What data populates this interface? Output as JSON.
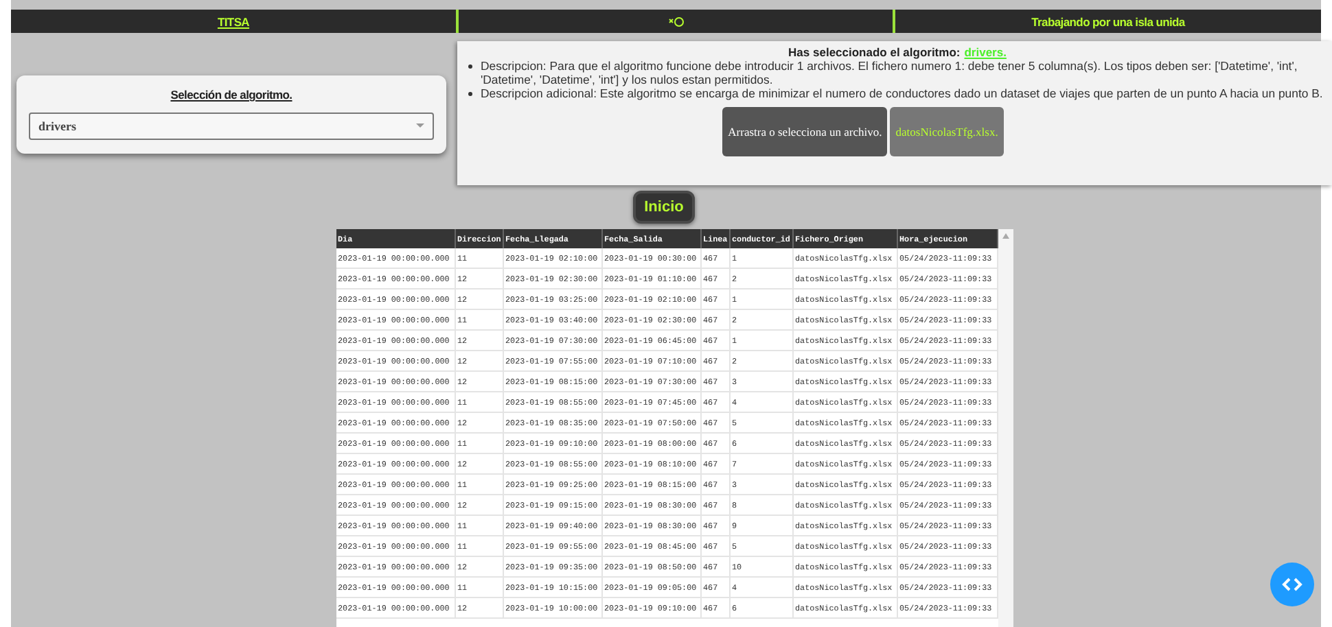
{
  "top_bar": {
    "brand": "TITSA",
    "slogan": "Trabajando por una isla unida"
  },
  "algorithm_selector": {
    "title": "Selección de algoritmo.",
    "value": "drivers"
  },
  "info_panel": {
    "heading": "Has seleccionado el algoritmo:",
    "algorithm": "drivers.",
    "descriptions": [
      "Descripcion: Para que el algoritmo funcione debe introducir 1 archivos. El fichero numero 1: debe tener 5 columna(s). Los tipos deben ser: ['Datetime', 'int', 'Datetime', 'Datetime', 'int'] y los nulos estan permitidos.",
      "Descripcion adicional: Este algoritmo se encarga de minimizar el numero de conductores dado un dataset de viajes que parten de un punto A hacia un punto B."
    ],
    "upload_button": "Arrastra o selecciona un archivo.",
    "file_chip": "datosNicolasTfg.xlsx."
  },
  "start_button": "Inicio",
  "table": {
    "columns": [
      "Dia",
      "Direccion",
      "Fecha_Llegada",
      "Fecha_Salida",
      "Linea",
      "conductor_id",
      "Fichero_Origen",
      "Hora_ejecucion"
    ],
    "rows": [
      [
        "2023-01-19 00:00:00.000",
        "11",
        "2023-01-19 02:10:00",
        "2023-01-19 00:30:00",
        "467",
        "1",
        "datosNicolasTfg.xlsx",
        "05/24/2023-11:09:33"
      ],
      [
        "2023-01-19 00:00:00.000",
        "12",
        "2023-01-19 02:30:00",
        "2023-01-19 01:10:00",
        "467",
        "2",
        "datosNicolasTfg.xlsx",
        "05/24/2023-11:09:33"
      ],
      [
        "2023-01-19 00:00:00.000",
        "12",
        "2023-01-19 03:25:00",
        "2023-01-19 02:10:00",
        "467",
        "1",
        "datosNicolasTfg.xlsx",
        "05/24/2023-11:09:33"
      ],
      [
        "2023-01-19 00:00:00.000",
        "11",
        "2023-01-19 03:40:00",
        "2023-01-19 02:30:00",
        "467",
        "2",
        "datosNicolasTfg.xlsx",
        "05/24/2023-11:09:33"
      ],
      [
        "2023-01-19 00:00:00.000",
        "12",
        "2023-01-19 07:30:00",
        "2023-01-19 06:45:00",
        "467",
        "1",
        "datosNicolasTfg.xlsx",
        "05/24/2023-11:09:33"
      ],
      [
        "2023-01-19 00:00:00.000",
        "12",
        "2023-01-19 07:55:00",
        "2023-01-19 07:10:00",
        "467",
        "2",
        "datosNicolasTfg.xlsx",
        "05/24/2023-11:09:33"
      ],
      [
        "2023-01-19 00:00:00.000",
        "12",
        "2023-01-19 08:15:00",
        "2023-01-19 07:30:00",
        "467",
        "3",
        "datosNicolasTfg.xlsx",
        "05/24/2023-11:09:33"
      ],
      [
        "2023-01-19 00:00:00.000",
        "11",
        "2023-01-19 08:55:00",
        "2023-01-19 07:45:00",
        "467",
        "4",
        "datosNicolasTfg.xlsx",
        "05/24/2023-11:09:33"
      ],
      [
        "2023-01-19 00:00:00.000",
        "12",
        "2023-01-19 08:35:00",
        "2023-01-19 07:50:00",
        "467",
        "5",
        "datosNicolasTfg.xlsx",
        "05/24/2023-11:09:33"
      ],
      [
        "2023-01-19 00:00:00.000",
        "11",
        "2023-01-19 09:10:00",
        "2023-01-19 08:00:00",
        "467",
        "6",
        "datosNicolasTfg.xlsx",
        "05/24/2023-11:09:33"
      ],
      [
        "2023-01-19 00:00:00.000",
        "12",
        "2023-01-19 08:55:00",
        "2023-01-19 08:10:00",
        "467",
        "7",
        "datosNicolasTfg.xlsx",
        "05/24/2023-11:09:33"
      ],
      [
        "2023-01-19 00:00:00.000",
        "11",
        "2023-01-19 09:25:00",
        "2023-01-19 08:15:00",
        "467",
        "3",
        "datosNicolasTfg.xlsx",
        "05/24/2023-11:09:33"
      ],
      [
        "2023-01-19 00:00:00.000",
        "12",
        "2023-01-19 09:15:00",
        "2023-01-19 08:30:00",
        "467",
        "8",
        "datosNicolasTfg.xlsx",
        "05/24/2023-11:09:33"
      ],
      [
        "2023-01-19 00:00:00.000",
        "11",
        "2023-01-19 09:40:00",
        "2023-01-19 08:30:00",
        "467",
        "9",
        "datosNicolasTfg.xlsx",
        "05/24/2023-11:09:33"
      ],
      [
        "2023-01-19 00:00:00.000",
        "11",
        "2023-01-19 09:55:00",
        "2023-01-19 08:45:00",
        "467",
        "5",
        "datosNicolasTfg.xlsx",
        "05/24/2023-11:09:33"
      ],
      [
        "2023-01-19 00:00:00.000",
        "12",
        "2023-01-19 09:35:00",
        "2023-01-19 08:50:00",
        "467",
        "10",
        "datosNicolasTfg.xlsx",
        "05/24/2023-11:09:33"
      ],
      [
        "2023-01-19 00:00:00.000",
        "11",
        "2023-01-19 10:15:00",
        "2023-01-19 09:05:00",
        "467",
        "4",
        "datosNicolasTfg.xlsx",
        "05/24/2023-11:09:33"
      ],
      [
        "2023-01-19 00:00:00.000",
        "12",
        "2023-01-19 10:00:00",
        "2023-01-19 09:10:00",
        "467",
        "6",
        "datosNicolasTfg.xlsx",
        "05/24/2023-11:09:33"
      ]
    ]
  }
}
